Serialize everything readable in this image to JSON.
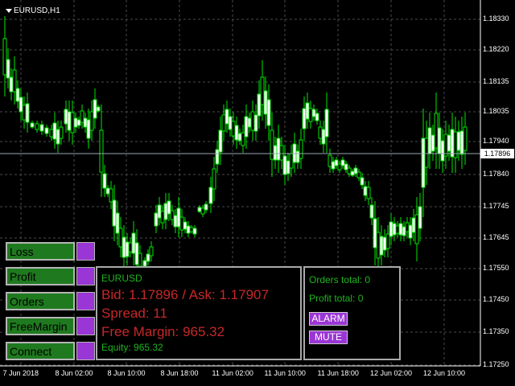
{
  "chart": {
    "title": "EURUSD,H1",
    "current_price": "1.17896",
    "price_labels": [
      "1.18330",
      "1.18220",
      "1.18135",
      "1.18035",
      "1.17940",
      "1.17840",
      "1.17745",
      "1.17645",
      "1.17550",
      "1.17450",
      "1.17350",
      "1.17250"
    ],
    "time_labels": [
      "7 Jun 2018",
      "8 Jun 02:00",
      "8 Jun 10:00",
      "8 Jun 18:00",
      "11 Jun 02:00",
      "11 Jun 10:00",
      "11 Jun 18:00",
      "12 Jun 02:00",
      "12 Jun 10:00"
    ],
    "colors": {
      "candle": "#00e600",
      "grid": "#4a4a4a",
      "price_line": "#9aa6b5"
    }
  },
  "buttons": [
    {
      "label": "Loss"
    },
    {
      "label": "Profit"
    },
    {
      "label": "Orders"
    },
    {
      "label": "FreeMargin"
    },
    {
      "label": "Connect"
    }
  ],
  "info": {
    "symbol": "EURUSD",
    "bid_ask": "Bid: 1.17896 / Ask: 1.17907",
    "spread": "Spread: 11",
    "free_margin": "Free Margin: 965.32",
    "equity": "Equity: 965.32"
  },
  "stats": {
    "orders_total": "Orders total: 0",
    "profit_total": "Profit total: 0",
    "alarm_label": "ALARM",
    "mute_label": "MUTE"
  }
}
